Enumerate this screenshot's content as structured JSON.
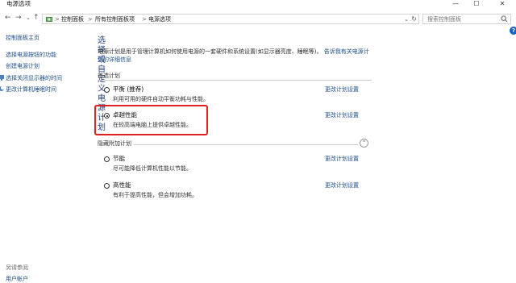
{
  "window": {
    "title": "电源选项",
    "controls": {
      "minimize": "—",
      "maximize": "☐",
      "close": "✕"
    }
  },
  "address": {
    "back": "←",
    "forward": "→",
    "up": "↑",
    "crumbs": [
      "控制面板",
      "所有控制面板项",
      "电源选项"
    ],
    "separator": ">",
    "search_placeholder": "搜索控制面板"
  },
  "sidebar": {
    "home": "控制面板主页",
    "items": [
      "选择电源按钮的功能",
      "创建电源计划",
      "选择关闭显示器的时间",
      "更改计算机睡眠时间"
    ],
    "see_also": "另请参阅",
    "user_accounts": "用户帐户"
  },
  "main": {
    "heading": "选择或自定义电源计划",
    "description": "电源计划是用于管理计算机如何使用电源的一套硬件和系统设置(如显示器亮度、睡眠等)。",
    "description_link": "告诉我有关电源计划的详细信息",
    "preferred_label": "首选计划",
    "hidden_label": "隐藏附加计划",
    "change_label": "更改计划设置",
    "plans": [
      {
        "name": "平衡 (推荐)",
        "desc": "利用可用的硬件自动平衡功耗与性能。",
        "selected": false
      },
      {
        "name": "卓越性能",
        "desc": "在较高端电脑上提供卓越性能。",
        "selected": true
      },
      {
        "name": "节能",
        "desc": "尽可能降低计算机性能以节能。",
        "selected": false
      },
      {
        "name": "高性能",
        "desc": "有利于提高性能，但会增加功耗。",
        "selected": false
      }
    ]
  },
  "help_label": "?",
  "colors": {
    "link": "#1e4e8c",
    "heading": "#1f3f7a",
    "highlight": "#e02020"
  }
}
